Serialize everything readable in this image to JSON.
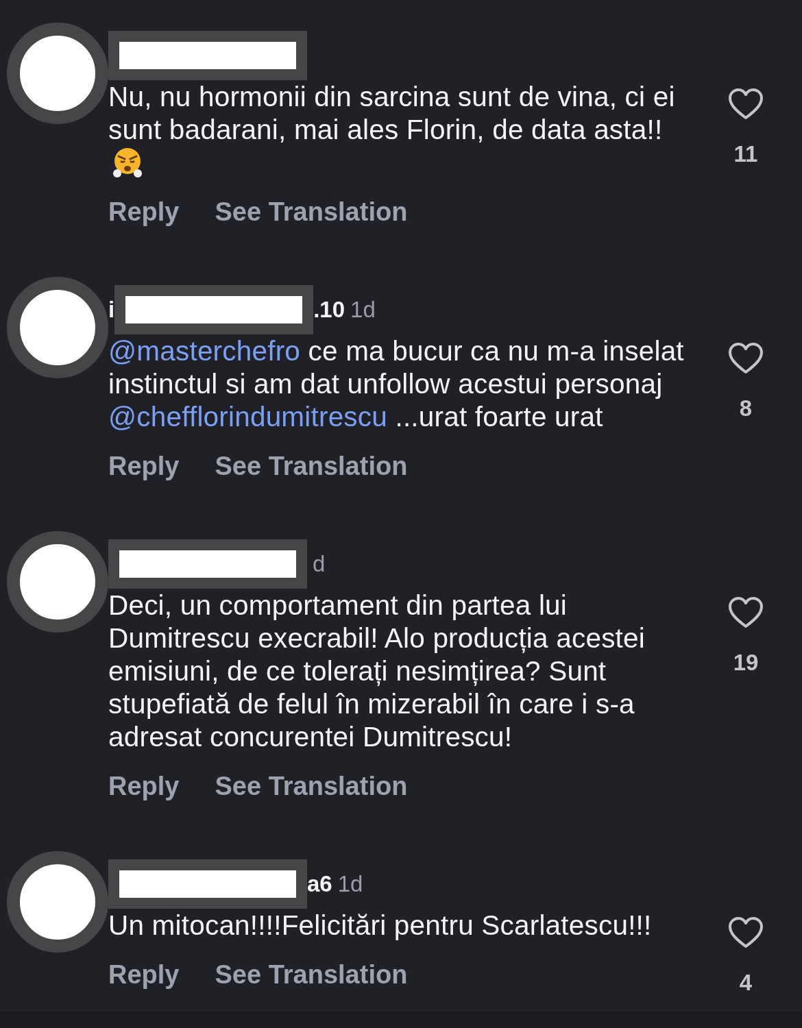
{
  "comments": [
    {
      "segments": [
        {
          "kind": "plain",
          "text": "Nu, nu hormonii din sarcina sunt de vina, ci ei sunt badarani, mai ales Florin, de data asta!!"
        },
        {
          "kind": "emoji"
        }
      ],
      "actions": [
        "Reply",
        "See Translation"
      ],
      "liked": false,
      "likes": "11"
    },
    {
      "name_prefix": "i",
      "name_suffix": ".10",
      "time": "1d",
      "segments": [
        {
          "kind": "mention",
          "text": "@masterchefro"
        },
        {
          "kind": "plain",
          "text": " ce ma bucur ca nu m-a inselat instinctul si am dat unfollow acestui personaj "
        },
        {
          "kind": "mention",
          "text": "@chefflorindumitrescu"
        },
        {
          "kind": "plain",
          "text": " ...urat foarte urat"
        }
      ],
      "actions": [
        "Reply",
        "See Translation"
      ],
      "liked": false,
      "likes": "8"
    },
    {
      "time": "d",
      "segments": [
        {
          "kind": "plain",
          "text": "Deci, un comportament din partea lui Dumitrescu execrabil! Alo producția acestei emisiuni, de ce tolerați nesimțirea? Sunt stupefiată de felul în mizerabil în care i s-a adresat concurentei Dumitrescu!"
        }
      ],
      "actions": [
        "Reply",
        "See Translation"
      ],
      "liked": false,
      "likes": "19"
    },
    {
      "name_suffix": "a6",
      "time": "1d",
      "segments": [
        {
          "kind": "plain",
          "text": "Un mitocan!!!!Felicitări pentru Scarlatescu!!!"
        }
      ],
      "actions": [
        "Reply",
        "See Translation"
      ],
      "liked": false,
      "likes": "4"
    }
  ]
}
